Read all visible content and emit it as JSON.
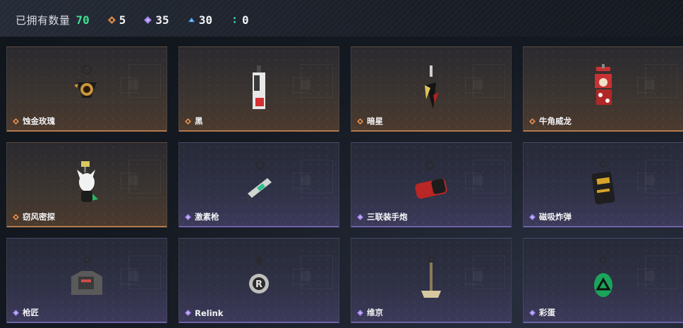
{
  "header": {
    "owned_label": "已拥有数量",
    "owned_count": "70",
    "stats": [
      {
        "icon": "orange-rarity-icon",
        "value": "5",
        "color": "#e08a4a"
      },
      {
        "icon": "purple-rarity-icon",
        "value": "35",
        "color": "#9b7fe6"
      },
      {
        "icon": "blue-rarity-icon",
        "value": "30",
        "color": "#4a9be6"
      },
      {
        "icon": "teal-rarity-icon",
        "value": "0",
        "color": "#3ec9b6"
      }
    ]
  },
  "items": [
    {
      "name": "蚀金玫瑰",
      "rarity": "orange",
      "icon": "rose-charm-icon"
    },
    {
      "name": "黑",
      "rarity": "orange",
      "icon": "black-tag-charm-icon"
    },
    {
      "name": "暗星",
      "rarity": "orange",
      "icon": "dark-star-charm-icon"
    },
    {
      "name": "牛角威龙",
      "rarity": "orange",
      "icon": "horned-dragon-charm-icon"
    },
    {
      "name": "窃风密探",
      "rarity": "orange",
      "icon": "wind-spy-charm-icon"
    },
    {
      "name": "激素枪",
      "rarity": "purple",
      "icon": "hormone-gun-charm-icon"
    },
    {
      "name": "三联装手炮",
      "rarity": "purple",
      "icon": "triple-hand-cannon-charm-icon"
    },
    {
      "name": "磁吸炸弹",
      "rarity": "purple",
      "icon": "magnetic-bomb-charm-icon"
    },
    {
      "name": "枪匠",
      "rarity": "purple",
      "icon": "gunsmith-charm-icon"
    },
    {
      "name": "Relink",
      "rarity": "purple",
      "icon": "relink-charm-icon"
    },
    {
      "name": "维京",
      "rarity": "purple",
      "icon": "viking-charm-icon"
    },
    {
      "name": "彩蛋",
      "rarity": "purple",
      "icon": "easter-egg-charm-icon"
    }
  ],
  "colors": {
    "owned_count": "#3ee08f",
    "orange_border": "#b47a4e",
    "purple_border": "#6e62a8"
  }
}
